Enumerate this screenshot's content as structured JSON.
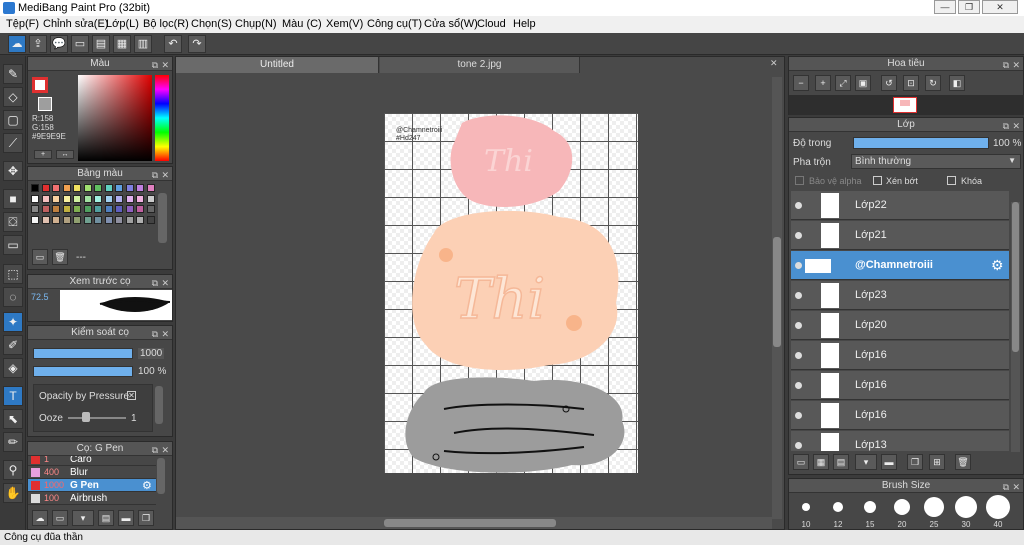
{
  "app": {
    "title": "MediBang Paint Pro (32bit)"
  },
  "menu": [
    "Tệp(F)",
    "Chỉnh sửa(E)",
    "Lớp(L)",
    "Bộ lọc(R)",
    "Chọn(S)",
    "Chụp(N)",
    "Màu (C)",
    "Xem(V)",
    "Công cụ(T)",
    "Cửa sổ(W)",
    "Cloud",
    "Help"
  ],
  "color_panel": {
    "title": "Màu",
    "r": "R:158",
    "g": "G:158",
    "hex": "#9E9E9E"
  },
  "palette_panel": {
    "title": "Bảng màu",
    "dots": "---"
  },
  "brush_preview": {
    "title": "Xem trước cọ",
    "size": "72.5"
  },
  "brush_control": {
    "title": "Kiểm soát cọ",
    "size": "1000",
    "opacity": "100 %",
    "opacity_pressure": "Opacity by Pressure",
    "ooze_label": "Ooze",
    "ooze_value": "1"
  },
  "brush_list": {
    "title": "Cọ: G Pen",
    "items": [
      {
        "size": "1",
        "name": "Carô",
        "color": "#e03030"
      },
      {
        "size": "400",
        "name": "Blur",
        "color": "#e8a0e0"
      },
      {
        "size": "1000",
        "name": "G Pen",
        "color": "#e03030",
        "selected": true
      },
      {
        "size": "100",
        "name": "Airbrush",
        "color": "#ddd"
      }
    ]
  },
  "tabs": [
    "Untitled",
    "tone 2.jpg"
  ],
  "canvas": {
    "watermark_name": "@Chamnetroiii",
    "watermark_id": "#Hd247"
  },
  "navigator": {
    "title": "Hoa tiêu"
  },
  "layer_panel": {
    "title": "Lớp",
    "opacity_label": "Độ trong",
    "opacity_value": "100 %",
    "blend_label": "Pha trộn",
    "blend_value": "Bình thường",
    "protect_alpha": "Bảo vệ alpha",
    "clip": "Xén bớt",
    "lock": "Khóa",
    "layers": [
      {
        "name": "Lớp22"
      },
      {
        "name": "Lớp21"
      },
      {
        "name": "@Chamnetroiii",
        "selected": true
      },
      {
        "name": "Lớp23"
      },
      {
        "name": "Lớp20"
      },
      {
        "name": "Lớp16"
      },
      {
        "name": "Lớp16"
      },
      {
        "name": "Lớp16"
      },
      {
        "name": "Lớp13"
      }
    ]
  },
  "brush_size_panel": {
    "title": "Brush Size",
    "sizes": [
      "10",
      "12",
      "15",
      "20",
      "25",
      "30",
      "40"
    ]
  },
  "status": {
    "text": "Công cụ đũa thần"
  },
  "colors": {
    "accent": "#4a90d0",
    "panel": "#474747",
    "pink": "#f7b7b9",
    "peach": "#fcd0b5",
    "gray": "#9c9c9c"
  }
}
